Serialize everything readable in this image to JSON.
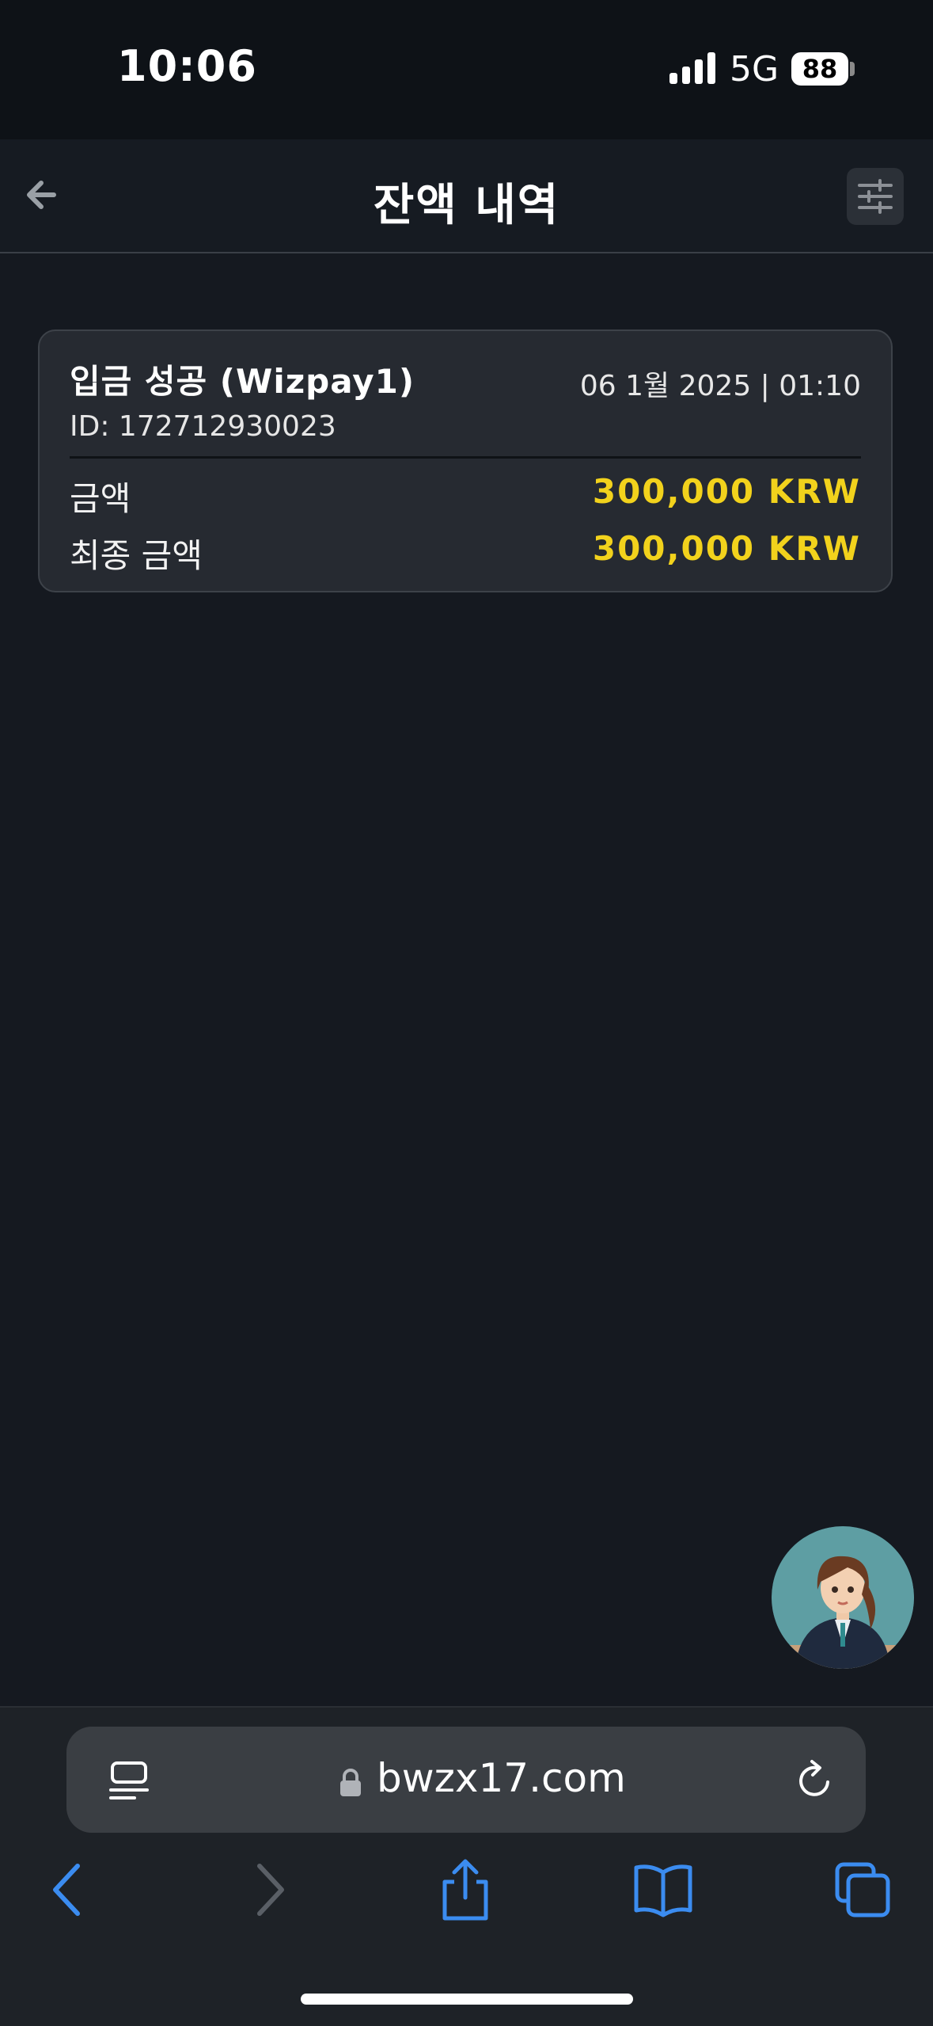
{
  "status": {
    "time": "10:06",
    "network": "5G",
    "battery": "88"
  },
  "header": {
    "title": "잔액 내역"
  },
  "transaction": {
    "title": "입금 성공 (Wizpay1)",
    "datetime": "06 1월 2025 | 01:10",
    "id": "ID: 172712930023",
    "amount_label": "금액",
    "amount_value": "300,000 KRW",
    "final_label": "최종 금액",
    "final_value": "300,000 KRW"
  },
  "browser": {
    "url": "bwzx17.com"
  },
  "colors": {
    "accent": "#f2d21c",
    "browser_blue": "#3b8cf0",
    "background": "#151920"
  },
  "icons": {
    "back": "arrow-left-icon",
    "filter": "sliders-icon",
    "tabs_view": "page-menu-icon",
    "lock": "lock-icon",
    "reload": "reload-icon",
    "nav_back": "chevron-left-icon",
    "nav_forward": "chevron-right-icon",
    "share": "share-icon",
    "bookmarks": "book-icon",
    "tabs": "tabs-icon"
  }
}
